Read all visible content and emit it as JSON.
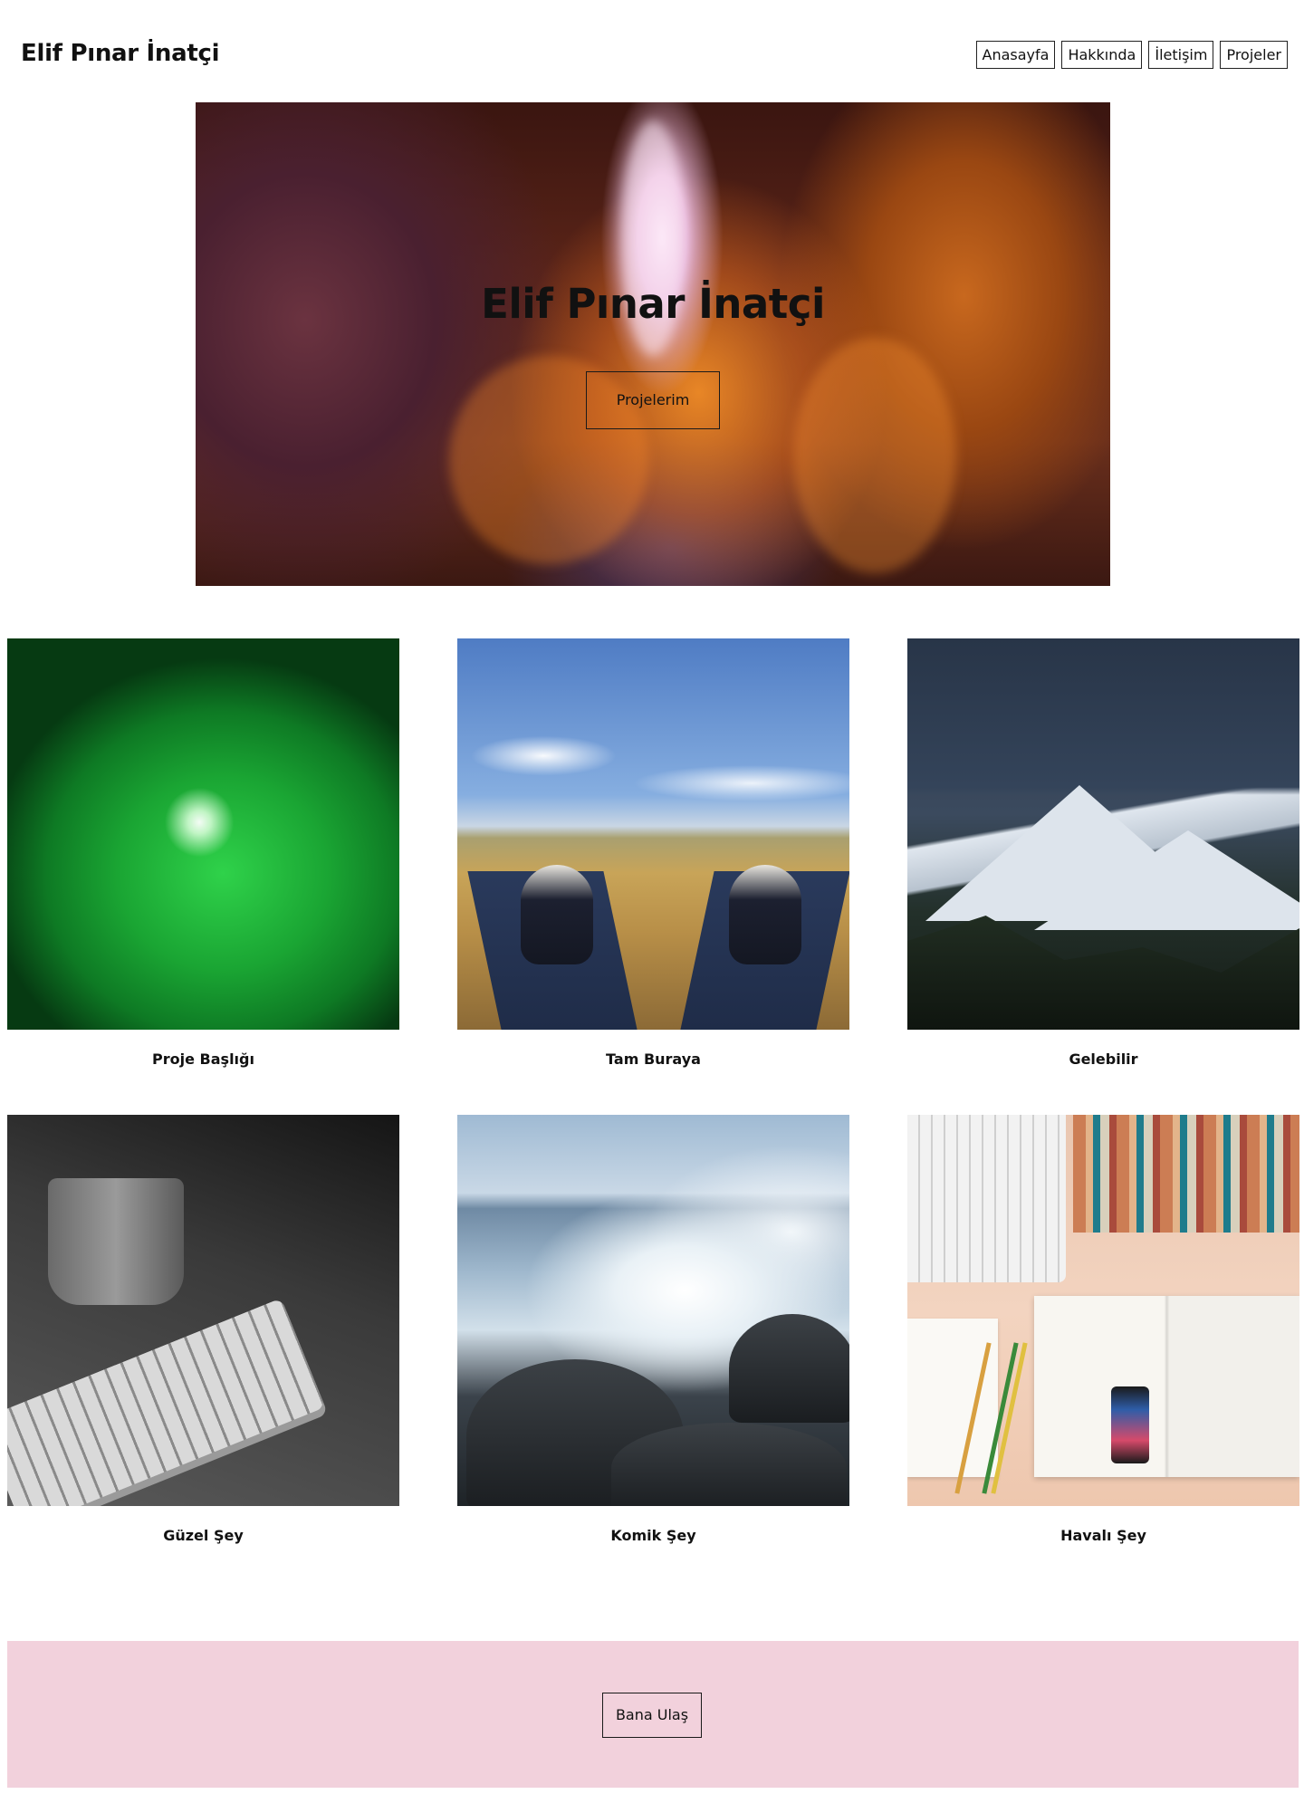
{
  "header": {
    "site_title": "Elif Pınar İnatçi",
    "nav": [
      {
        "label": "Anasayfa"
      },
      {
        "label": "Hakkında"
      },
      {
        "label": "İletişim"
      },
      {
        "label": "Projeler"
      }
    ]
  },
  "hero": {
    "title": "Elif Pınar İnatçi",
    "button_label": "Projelerim",
    "image": "canyon-photo"
  },
  "projects": [
    {
      "caption": "Proje Başlığı",
      "image": "green-leaf-waterdrop-photo"
    },
    {
      "caption": "Tam Buraya",
      "image": "sneakers-on-field-photo"
    },
    {
      "caption": "Gelebilir",
      "image": "snowy-mountains-night-photo"
    },
    {
      "caption": "Güzel Şey",
      "image": "mug-and-keyboard-photo"
    },
    {
      "caption": "Komik Şey",
      "image": "ocean-wave-rocks-photo"
    },
    {
      "caption": "Havalı Şey",
      "image": "desk-books-magazine-photo"
    }
  ],
  "footer": {
    "button_label": "Bana Ulaş",
    "background_color": "#f2d1dc"
  }
}
